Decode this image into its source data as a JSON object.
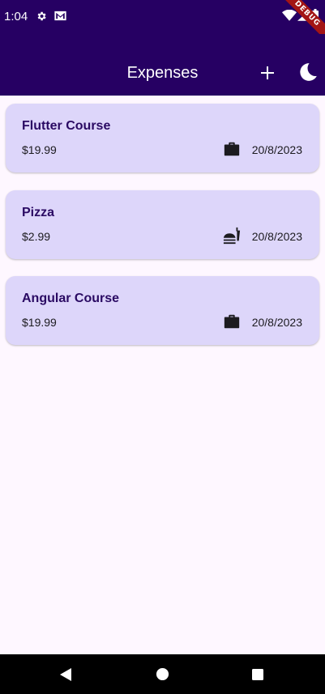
{
  "status_bar": {
    "time": "1:04",
    "debug_label": "DEBUG"
  },
  "app_bar": {
    "title": "Expenses"
  },
  "expenses": [
    {
      "title": "Flutter Course",
      "amount": "$19.99",
      "date": "20/8/2023",
      "category_icon": "work-briefcase-icon"
    },
    {
      "title": "Pizza",
      "amount": "$2.99",
      "date": "20/8/2023",
      "category_icon": "food-icon"
    },
    {
      "title": "Angular Course",
      "amount": "$19.99",
      "date": "20/8/2023",
      "category_icon": "work-briefcase-icon"
    }
  ],
  "colors": {
    "app_bar": "#260063",
    "card_background": "#ddd6fa",
    "title_text": "#2a0a63",
    "page_background": "#fef7ff"
  }
}
